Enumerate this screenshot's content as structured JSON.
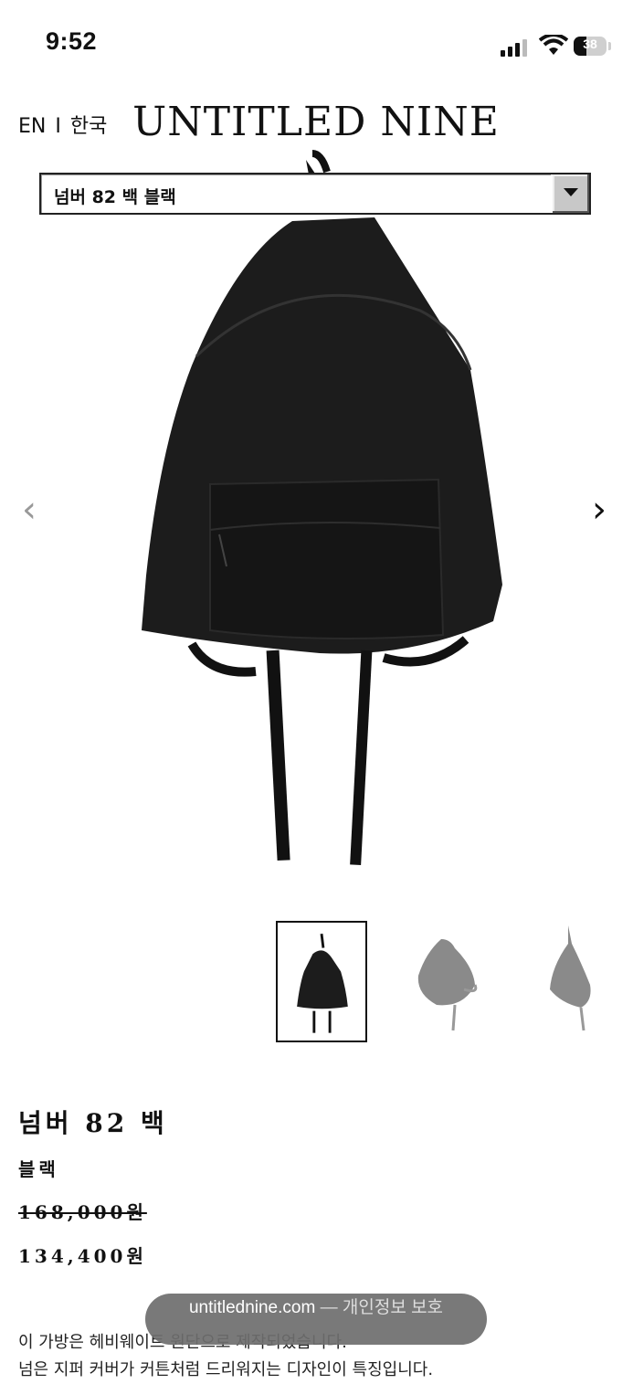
{
  "status_bar": {
    "time": "9:52",
    "battery_level": "38"
  },
  "header": {
    "lang_en": "EN",
    "lang_sep": "I",
    "lang_ko": "한국",
    "logo": "UNTITLED NINE"
  },
  "product_select": {
    "selected": "넘버 82 백 블랙"
  },
  "gallery": {
    "thumbnail_count": 3,
    "selected_index": 0
  },
  "product": {
    "name": "넘버 82 백",
    "color": "블랙",
    "original_price": "168,000원",
    "sale_price": "134,400원",
    "description_line1": "이 가방은 헤비웨이트 원단으로 제작되었습니다.",
    "description_line2": "넘은 지퍼 커버가 커튼처럼 드리워지는 디자인이 특징입니다."
  },
  "toast": {
    "domain": "untitlednine.com",
    "dash": "—",
    "label": "개인정보 보호"
  },
  "colors": {
    "background": "#ffffff",
    "text": "#111111",
    "toast": "#6e6e6e"
  }
}
